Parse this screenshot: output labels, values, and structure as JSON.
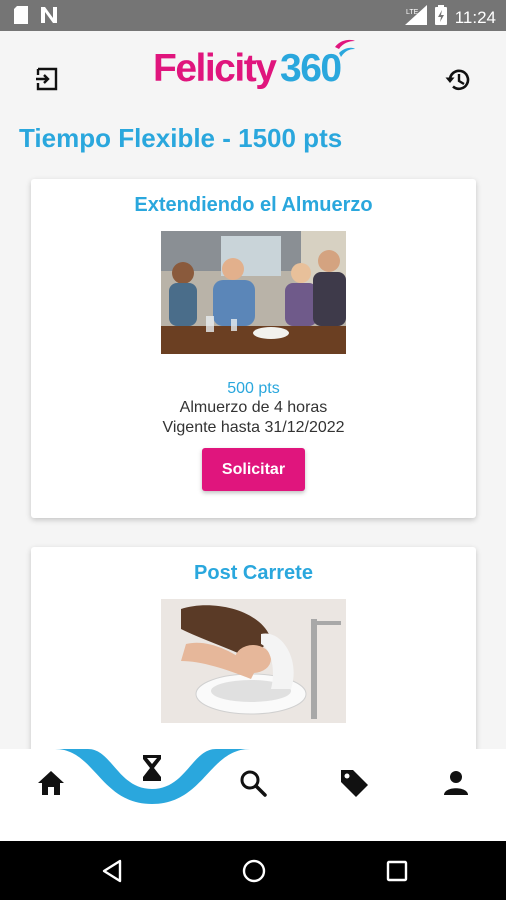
{
  "status_bar": {
    "time": "11:24",
    "network_label": "LTE"
  },
  "header": {
    "logo_part_a": "Felicity",
    "logo_part_b": "360",
    "logout_icon": "logout-icon",
    "history_icon": "history-icon"
  },
  "page_title": "Tiempo Flexible - 1500 pts",
  "cards": [
    {
      "title": "Extendiendo el Almuerzo",
      "points": "500 pts",
      "description": "Almuerzo de 4 horas",
      "validity": "Vigente hasta 31/12/2022",
      "button_label": "Solicitar"
    },
    {
      "title": "Post Carrete"
    }
  ],
  "bottom_nav": {
    "items": [
      "home-icon",
      "hourglass-icon",
      "search-icon",
      "tag-icon",
      "person-icon"
    ],
    "active": "hourglass-icon"
  },
  "colors": {
    "brand_pink": "#e0157d",
    "brand_blue": "#2aa7dd",
    "status_bar": "#757575"
  }
}
